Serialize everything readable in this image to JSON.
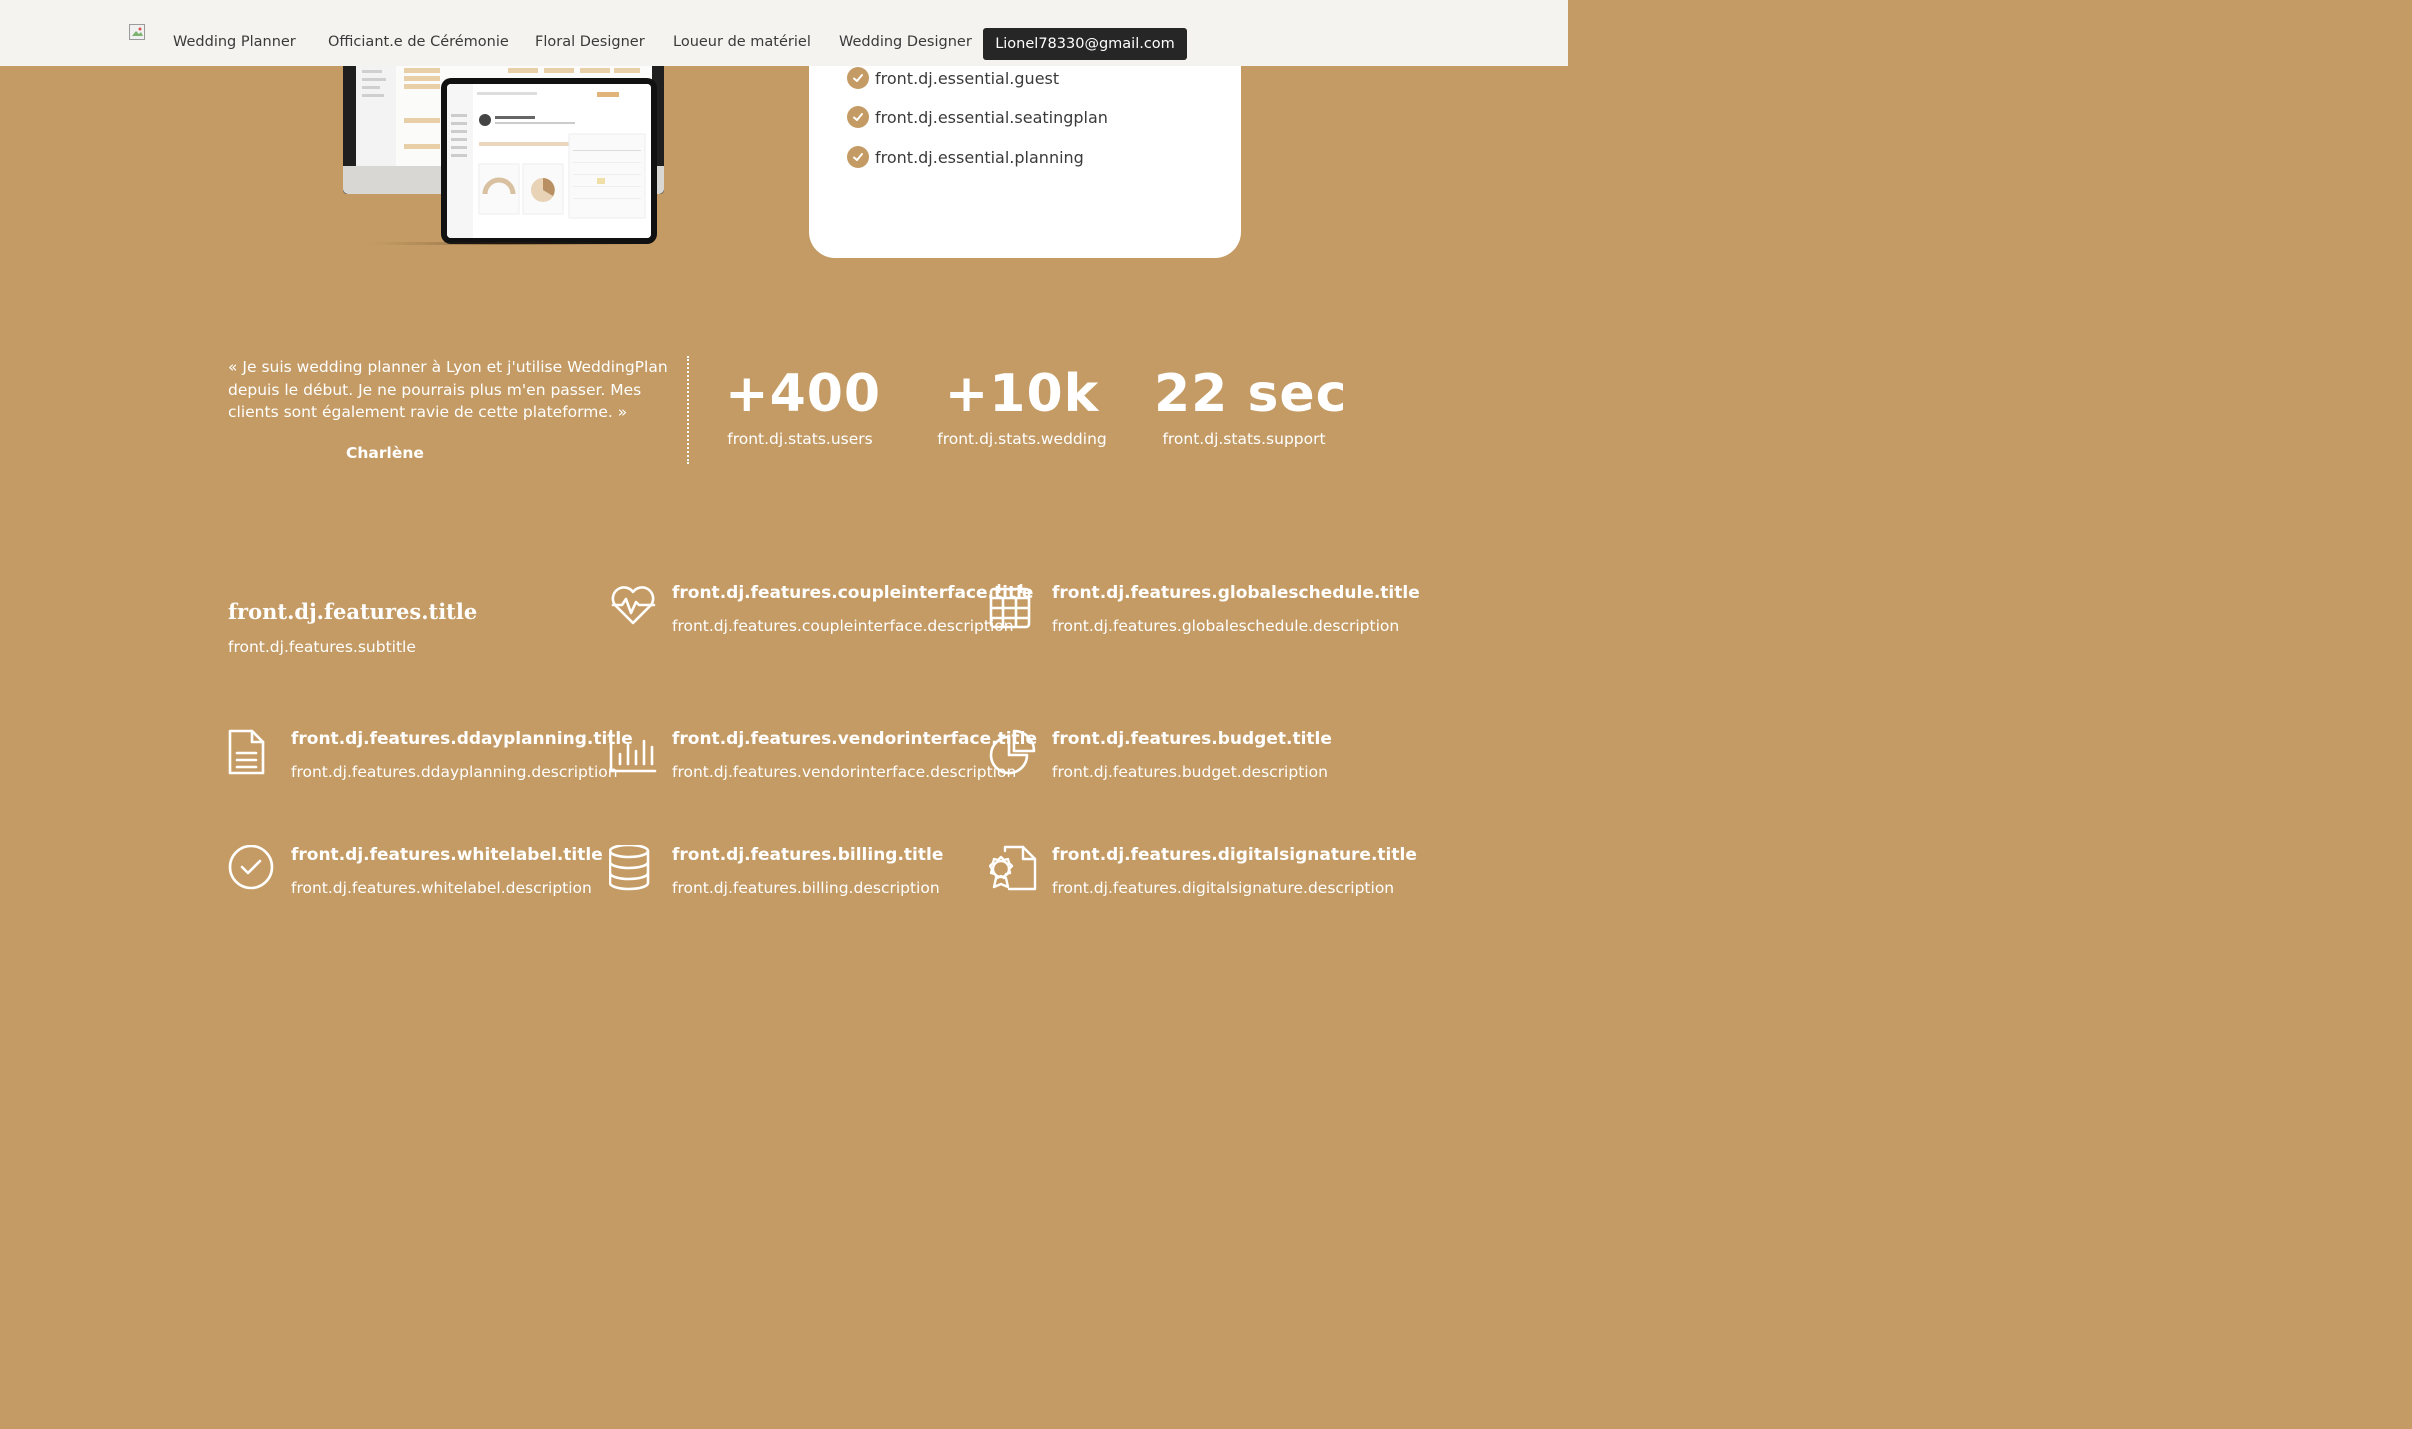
{
  "nav": {
    "links": [
      "Wedding Planner",
      "Officiant.e de Cérémonie",
      "Floral Designer",
      "Loueur de matériel",
      "Wedding Designer"
    ],
    "user_email": "Lionel78330@gmail.com"
  },
  "card": {
    "items": [
      "front.dj.essential.guest",
      "front.dj.essential.seatingplan",
      "front.dj.essential.planning"
    ]
  },
  "testimonial": {
    "quote": "« Je suis wedding planner à Lyon et j'utilise WeddingPlan depuis le début. Je ne pourrais plus m'en passer. Mes clients sont également ravie de cette plateforme. »",
    "author": "Charlène"
  },
  "stats": [
    {
      "value": "+400",
      "label": "front.dj.stats.users"
    },
    {
      "value": "+10k",
      "label": "front.dj.stats.wedding"
    },
    {
      "value": "22 sec",
      "label": "front.dj.stats.support"
    }
  ],
  "features": {
    "title": "front.dj.features.title",
    "subtitle": "front.dj.features.subtitle",
    "items": [
      {
        "icon": "heart-pulse-icon",
        "title": "front.dj.features.coupleinterface.title",
        "description": "front.dj.features.coupleinterface.description"
      },
      {
        "icon": "calendar-grid-icon",
        "title": "front.dj.features.globaleschedule.title",
        "description": "front.dj.features.globaleschedule.description"
      },
      {
        "icon": "document-icon",
        "title": "front.dj.features.ddayplanning.title",
        "description": "front.dj.features.ddayplanning.description"
      },
      {
        "icon": "bar-chart-icon",
        "title": "front.dj.features.vendorinterface.title",
        "description": "front.dj.features.vendorinterface.description"
      },
      {
        "icon": "pie-chart-icon",
        "title": "front.dj.features.budget.title",
        "description": "front.dj.features.budget.description"
      },
      {
        "icon": "check-circle-icon",
        "title": "front.dj.features.whitelabel.title",
        "description": "front.dj.features.whitelabel.description"
      },
      {
        "icon": "database-icon",
        "title": "front.dj.features.billing.title",
        "description": "front.dj.features.billing.description"
      },
      {
        "icon": "certificate-document-icon",
        "title": "front.dj.features.digitalsignature.title",
        "description": "front.dj.features.digitalsignature.description"
      }
    ]
  },
  "colors": {
    "background": "#c49b64",
    "nav_background": "#f4f3f0",
    "button_dark": "#262626",
    "card": "#ffffff",
    "accent": "#c49b64"
  }
}
